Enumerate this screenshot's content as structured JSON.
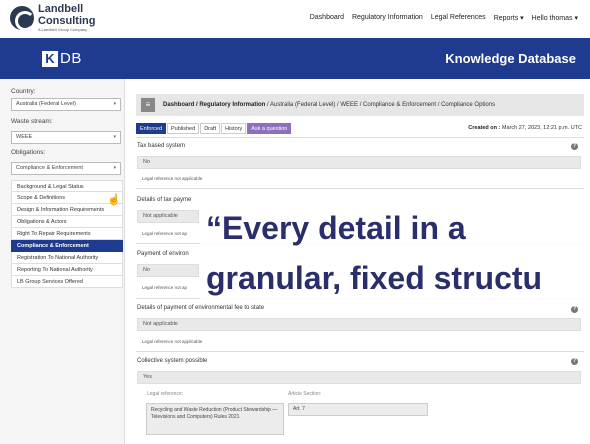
{
  "brand": {
    "name_line1": "Landbell",
    "name_line2": "Consulting",
    "subtitle": "A Landbell Group Company"
  },
  "nav": {
    "links": [
      "Dashboard",
      "Regulatory Information",
      "Legal References",
      "Reports",
      "Hello thomas"
    ]
  },
  "header": {
    "app_letter": "K",
    "app_suffix": "DB",
    "title": "Knowledge Database",
    "color": "#1f3b8f"
  },
  "sidebar": {
    "country_label": "Country:",
    "country_value": "Australia (Federal Level)",
    "waste_label": "Waste stream:",
    "waste_value": "WEEE",
    "obligations_label": "Obligations:",
    "obligations_value": "Compliance & Enforcement",
    "menu": [
      "Background & Legal Status",
      "Scope & Definitions",
      "Design & Information Requirements",
      "Obligations & Actors",
      "Right To Repair Requirements",
      "Compliance & Enforcement",
      "Registration To National Authority",
      "Reporting To National Authority",
      "LB Group Services Offered"
    ],
    "active_index": 5
  },
  "breadcrumb": {
    "bold": "Dashboard / Regulatory Information",
    "rest": " / Australia (Federal Level) / WEEE / Compliance & Enforcement / Compliance Options"
  },
  "tabs": {
    "items": [
      "Enforced",
      "Published",
      "Draft",
      "History"
    ],
    "ask": "Ask a question",
    "accent": "#8e6fbf"
  },
  "created": {
    "label": "Created on :",
    "value": " March 27, 2023, 12:21 p.m. UTC"
  },
  "fields": {
    "tax_title": "Tax based system",
    "tax_value": "No",
    "legal_na": "Legal reference not applicable",
    "details_tax_title": "Details of tax payme",
    "details_tax_value": "Not applicable",
    "legal_na_short": "Legal reference not ap",
    "payment_title": "Payment of environ",
    "payment_value": "No",
    "details_payment_title": "Details of payment of environmental fee to state",
    "details_payment_value": "Not applicable",
    "collective_title": "Collective system possible",
    "collective_value": "Yes",
    "legal_ref_label": "Legal reference:",
    "article_label": "Article Section:",
    "legal_ref_value": "Recycling and Waste Reduction (Product Stewardship — Televisions and Computers) Rules 2021",
    "article_value": "Art. 7"
  },
  "overlay": {
    "line1": "“Every detail in a",
    "line2": "granular, fixed structu",
    "color": "#2a2f6b"
  }
}
